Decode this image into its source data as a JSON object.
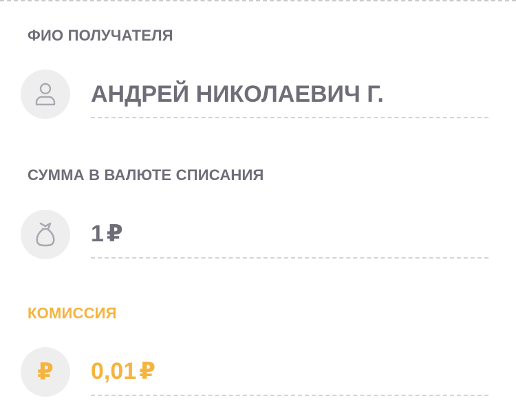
{
  "recipient": {
    "label": "ФИО ПОЛУЧАТЕЛЯ",
    "value": "АНДРЕЙ НИКОЛАЕВИЧ Г.",
    "icon": "person-icon"
  },
  "amount": {
    "label": "СУММА В ВАЛЮТЕ СПИСАНИЯ",
    "value": "1",
    "currency": "₽",
    "icon": "money-bag-icon"
  },
  "commission": {
    "label": "КОМИССИЯ",
    "value": "0,01",
    "currency": "₽",
    "icon": "ruble-icon",
    "icon_glyph": "₽",
    "accent_color": "#f4b43f"
  }
}
